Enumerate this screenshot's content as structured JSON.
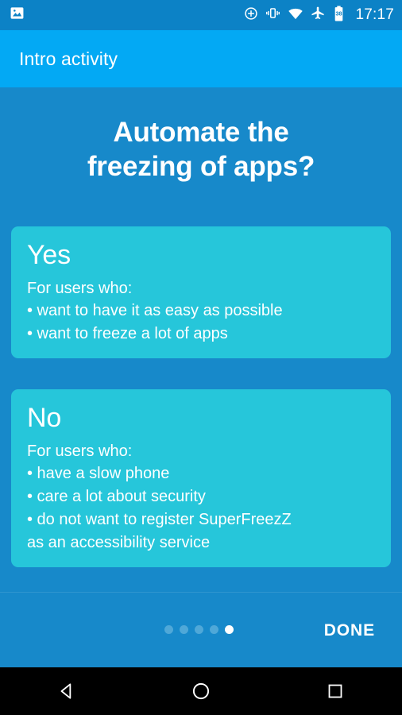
{
  "status_bar": {
    "notification_icon": "image-icon",
    "icons": [
      {
        "name": "sync-add-icon"
      },
      {
        "name": "vibrate-mode-icon"
      },
      {
        "name": "wifi-icon"
      },
      {
        "name": "airplane-mode-icon"
      },
      {
        "name": "battery-icon",
        "level": "38"
      }
    ],
    "clock": "17:17",
    "background": "#0c82c6"
  },
  "app_bar": {
    "title": "Intro activity",
    "background": "#03A9F4"
  },
  "content": {
    "headline_line1": "Automate the",
    "headline_line2": "freezing of apps?",
    "background": "#1789CA",
    "cards": [
      {
        "title": "Yes",
        "lead": "For users who:",
        "items": [
          "• want to have it as easy as possible",
          "• want to freeze a lot of apps"
        ],
        "color": "#26C6DA"
      },
      {
        "title": "No",
        "lead": "For users who:",
        "items": [
          "• have a slow phone",
          "• care a lot about security",
          "• do not want to register SuperFreezZ",
          "as an accessibility service"
        ],
        "color": "#26C6DA"
      }
    ]
  },
  "bottom_bar": {
    "done_label": "DONE",
    "dots": {
      "total": 5,
      "active_index": 4,
      "inactive_color": "#4FA8D8",
      "active_color": "#FFFFFF"
    }
  },
  "nav_bar": {
    "back": "back-icon",
    "home": "home-icon",
    "recents": "recents-icon",
    "background": "#000000"
  }
}
